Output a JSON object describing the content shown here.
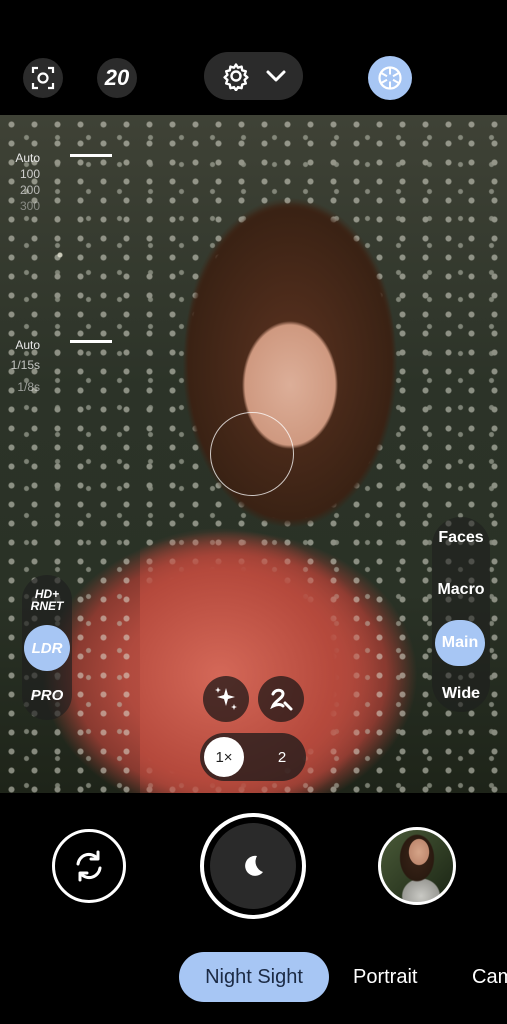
{
  "top_bar": {
    "timer_label": "20"
  },
  "dials": {
    "iso": [
      "Auto",
      "100",
      "200",
      "300"
    ],
    "shutter": [
      "Auto",
      "1/15s",
      "1/8s"
    ]
  },
  "left_modes": {
    "hdr": "HD+\nRNET",
    "hdr_line1": "HD+",
    "hdr_line2": "RNET",
    "ldr": "LDR",
    "pro": "PRO"
  },
  "lenses": {
    "faces": "Faces",
    "macro": "Macro",
    "main": "Main",
    "wide": "Wide"
  },
  "zoom": {
    "one": "1×",
    "two": "2"
  },
  "modes": {
    "active": "Night Sight",
    "portrait": "Portrait",
    "camera": "Cam"
  },
  "colors": {
    "accent": "#a7c6f4",
    "bar": "#000000"
  },
  "icons": [
    "scan-icon",
    "timer",
    "gear-icon",
    "chevron-down-icon",
    "aperture-icon",
    "sparkles-icon",
    "retouch-icon",
    "switch-camera-icon",
    "moon-icon"
  ]
}
